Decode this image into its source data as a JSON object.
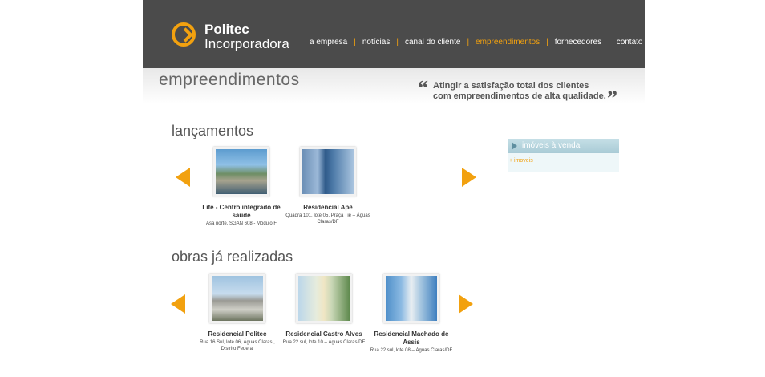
{
  "header": {
    "logo_line1": "Politec",
    "logo_line2": "Incorporadora",
    "nav": [
      "a empresa",
      "notícias",
      "canal do cliente",
      "empreendimentos",
      "fornecedores",
      "contato"
    ],
    "nav_active": "empreendimentos",
    "separator": "|"
  },
  "page": {
    "title": "empreendimentos",
    "quote_open": "“",
    "quote_line1": "Atingir a satisfação total dos clientes",
    "quote_line2": "com empreendimentos de alta qualidade.",
    "quote_close": "”"
  },
  "lancamentos": {
    "title": "lançamentos",
    "items": [
      {
        "title_line1": "Life - Centro integrado de",
        "title_line2": "saúde",
        "addr_line1": "Asa norte, SGAN 608 - Módulo F",
        "addr_line2": ""
      },
      {
        "title_line1": "Residencial Apê",
        "title_line2": "",
        "addr_line1": "Quadra 101, lote 05, Praça Tiê – Águas",
        "addr_line2": "Claras/DF"
      }
    ]
  },
  "obras": {
    "title": "obras já realizadas",
    "items": [
      {
        "title_line1": "Residencial Politec",
        "title_line2": "",
        "addr_line1": "Rua 16 Sul, lote 06, Águas Claras ,",
        "addr_line2": "Distrito Federal"
      },
      {
        "title_line1": "Residencial Castro Alves",
        "title_line2": "",
        "addr_line1": "Rua 22 sul, lote 10 – Águas Claras/DF",
        "addr_line2": ""
      },
      {
        "title_line1": "Residencial Machado de",
        "title_line2": "Assis",
        "addr_line1": "Rua 22 sul, lote 08 – Águas Claras/DF",
        "addr_line2": ""
      }
    ]
  },
  "sidebar": {
    "box_title": "imóveis à venda",
    "link": "+ imoveis"
  },
  "colors": {
    "header_bg": "#4b4b4b",
    "accent": "#f2a10f",
    "sidebox_bg": "#eef7f9"
  }
}
